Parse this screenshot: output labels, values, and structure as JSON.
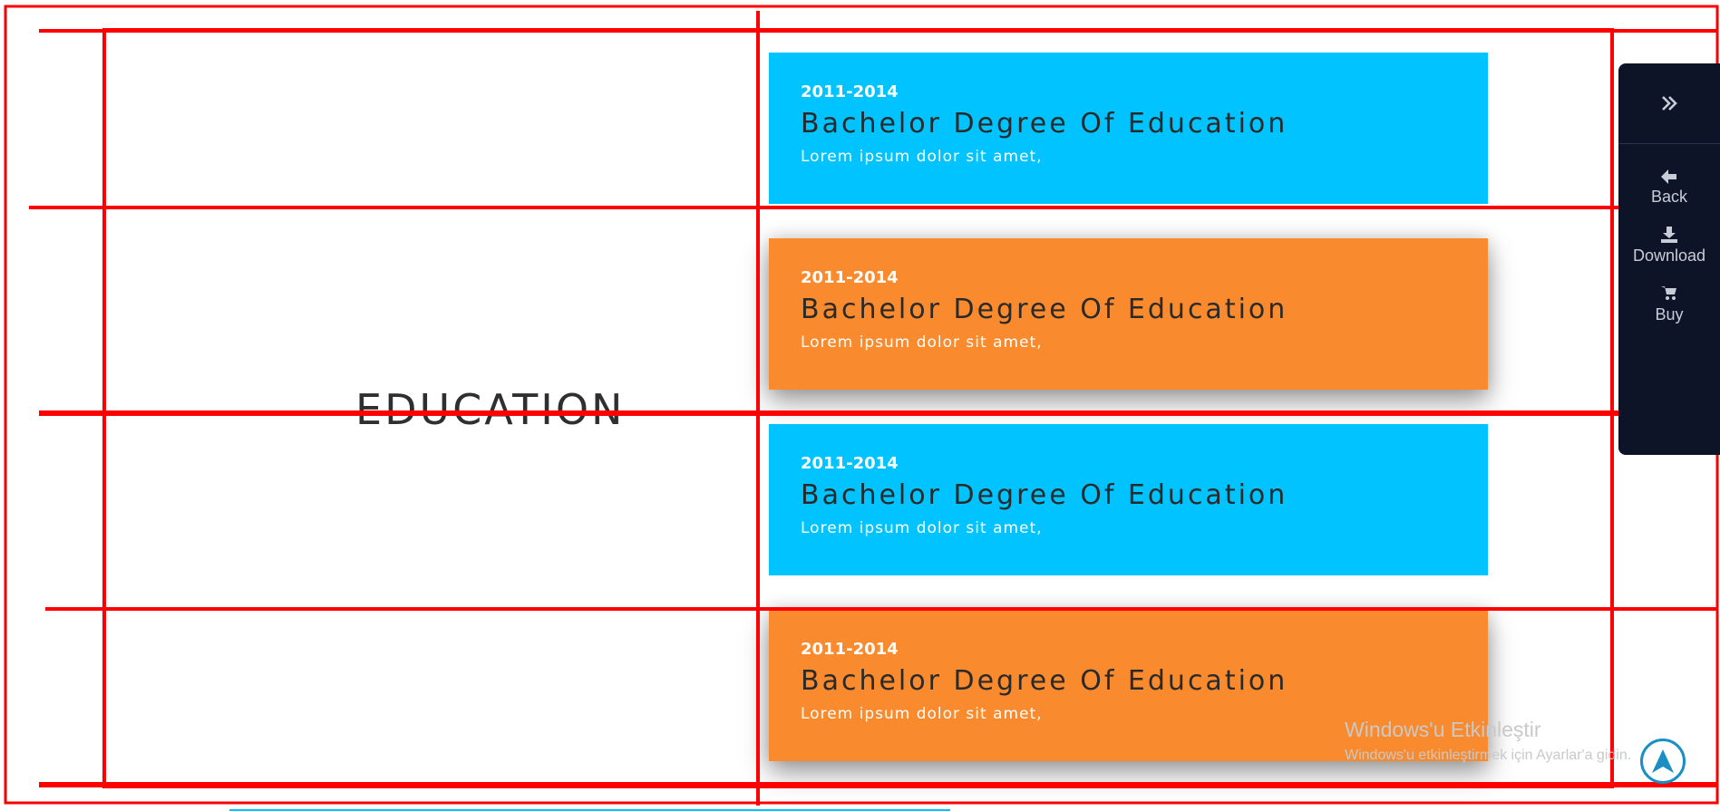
{
  "section": {
    "title": "EDUCATION"
  },
  "education": [
    {
      "years": "2011-2014",
      "title": "Bachelor Degree Of Education",
      "description": "Lorem ipsum dolor sit amet,",
      "color": "#00c3ff"
    },
    {
      "years": "2011-2014",
      "title": "Bachelor Degree Of Education",
      "description": "Lorem ipsum dolor sit amet,",
      "color": "#f98a2e"
    },
    {
      "years": "2011-2014",
      "title": "Bachelor Degree Of Education",
      "description": "Lorem ipsum dolor sit amet,",
      "color": "#00c3ff"
    },
    {
      "years": "2011-2014",
      "title": "Bachelor Degree Of Education",
      "description": "Lorem ipsum dolor sit amet,",
      "color": "#f98a2e"
    }
  ],
  "side_panel": {
    "toggle_icon": "double-chevron-right-icon",
    "items": [
      {
        "label": "Back",
        "icon": "arrow-left-icon"
      },
      {
        "label": "Download",
        "icon": "download-icon"
      },
      {
        "label": "Buy",
        "icon": "cart-icon"
      }
    ]
  },
  "watermark": {
    "title": "Windows'u Etkinleştir",
    "subtitle": "Windows'u etkinleştirmek için Ayarlar'a gidin."
  },
  "scroll_top": {
    "icon": "navigation-arrow-icon"
  },
  "colors": {
    "blue": "#00c3ff",
    "orange": "#f98a2e",
    "panel": "#0e1428",
    "guide_lines": "#ff0000"
  }
}
